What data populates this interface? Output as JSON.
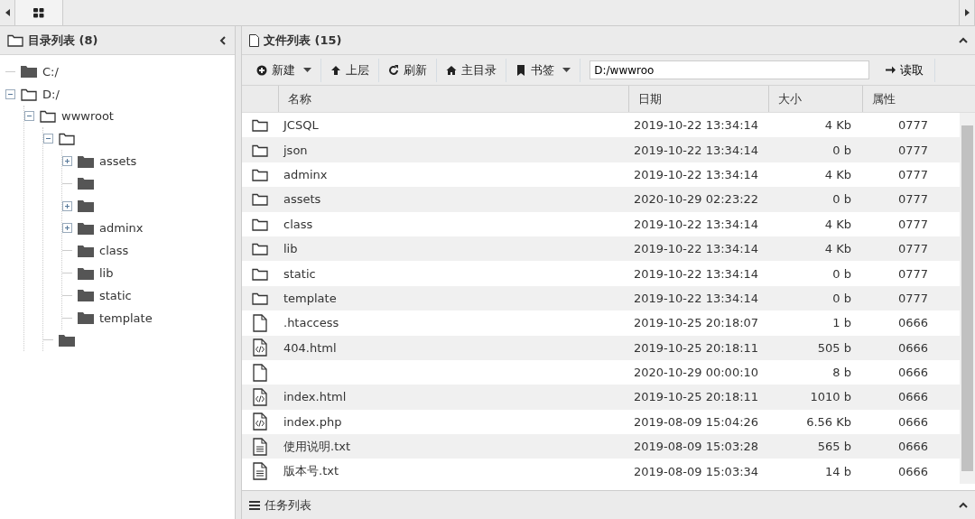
{
  "left_panel": {
    "title": "目录列表 (8)",
    "tree": [
      {
        "label": "C:/",
        "kind": "drive"
      },
      {
        "label": "D:/",
        "kind": "folder",
        "expanded": true,
        "children": [
          {
            "label": "wwwroot",
            "kind": "folder",
            "expanded": true,
            "children": [
              {
                "kind": "folder",
                "expanded": true,
                "children": [
                  {
                    "label": "assets",
                    "kind": "dir",
                    "expanded": false
                  },
                  {
                    "kind": "dir"
                  },
                  {
                    "kind": "dir",
                    "expanded": false
                  },
                  {
                    "label": "adminx",
                    "kind": "dir",
                    "expanded": false
                  },
                  {
                    "label": "class",
                    "kind": "dir"
                  },
                  {
                    "label": "lib",
                    "kind": "dir"
                  },
                  {
                    "label": "static",
                    "kind": "dir"
                  },
                  {
                    "label": "template",
                    "kind": "dir"
                  }
                ]
              },
              {
                "kind": "dir"
              }
            ]
          }
        ]
      }
    ]
  },
  "right_panel": {
    "title": "文件列表 (15)",
    "toolbar": [
      {
        "label": "新建",
        "dropdown": true
      },
      {
        "label": "上层",
        "dropdown": false
      },
      {
        "label": "刷新",
        "dropdown": false
      },
      {
        "label": "主目录",
        "dropdown": false
      },
      {
        "label": "书签",
        "dropdown": true
      }
    ],
    "path": "D:/wwwroo",
    "go_button": "读取",
    "table": {
      "columns": [
        "名称",
        "日期",
        "大小",
        "属性"
      ],
      "rows": [
        {
          "kind": "folder",
          "name": "JCSQL",
          "date": "2019-10-22 13:34:14",
          "size": "4 Kb",
          "attr": "0777"
        },
        {
          "kind": "folder",
          "name": "json",
          "date": "2019-10-22 13:34:14",
          "size": "0 b",
          "attr": "0777"
        },
        {
          "kind": "folder",
          "name": "adminx",
          "date": "2019-10-22 13:34:14",
          "size": "4 Kb",
          "attr": "0777"
        },
        {
          "kind": "folder",
          "name": "assets",
          "date": "2020-10-29 02:23:22",
          "size": "0 b",
          "attr": "0777"
        },
        {
          "kind": "folder",
          "name": "class",
          "date": "2019-10-22 13:34:14",
          "size": "4 Kb",
          "attr": "0777"
        },
        {
          "kind": "folder",
          "name": "lib",
          "date": "2019-10-22 13:34:14",
          "size": "4 Kb",
          "attr": "0777"
        },
        {
          "kind": "folder",
          "name": "static",
          "date": "2019-10-22 13:34:14",
          "size": "0 b",
          "attr": "0777"
        },
        {
          "kind": "folder",
          "name": "template",
          "date": "2019-10-22 13:34:14",
          "size": "0 b",
          "attr": "0777"
        },
        {
          "kind": "file",
          "name": ".htaccess",
          "date": "2019-10-25 20:18:07",
          "size": "1 b",
          "attr": "0666"
        },
        {
          "kind": "code",
          "name": "404.html",
          "date": "2019-10-25 20:18:11",
          "size": "505 b",
          "attr": "0666"
        },
        {
          "kind": "file",
          "date": "2020-10-29 00:00:10",
          "size": "8 b",
          "attr": "0666"
        },
        {
          "kind": "code",
          "name": "index.html",
          "date": "2019-10-25 20:18:11",
          "size": "1010 b",
          "attr": "0666"
        },
        {
          "kind": "code",
          "name": "index.php",
          "date": "2019-08-09 15:04:26",
          "size": "6.56 Kb",
          "attr": "0666"
        },
        {
          "kind": "text",
          "name": "使用说明.txt",
          "date": "2019-08-09 15:03:28",
          "size": "565 b",
          "attr": "0666"
        },
        {
          "kind": "text",
          "name": "版本号.txt",
          "date": "2019-08-09 15:03:34",
          "size": "14 b",
          "attr": "0666"
        }
      ]
    }
  },
  "task_panel": {
    "title": "任务列表"
  }
}
